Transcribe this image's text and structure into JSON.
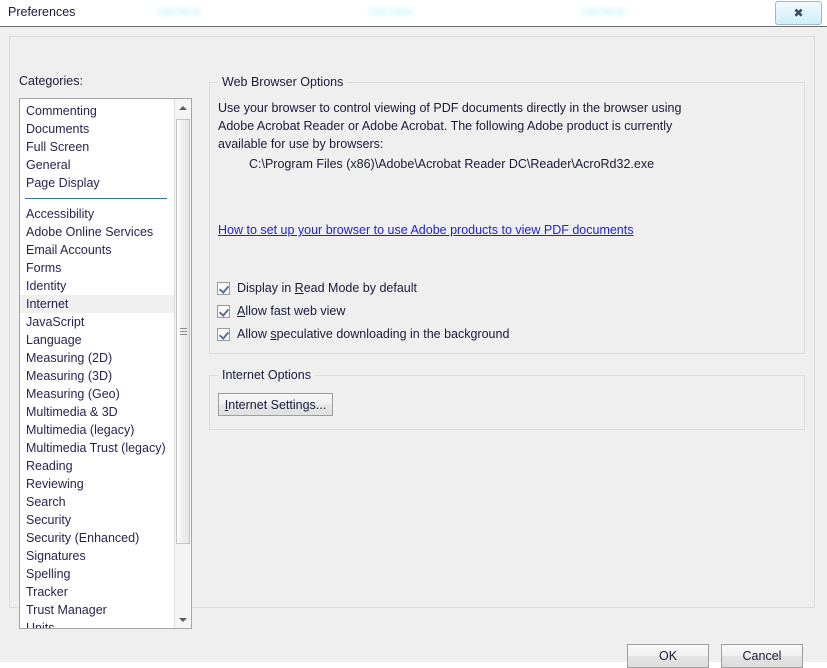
{
  "window": {
    "title": "Preferences",
    "close_glyph": "✖",
    "ghost_labels": [
      "Get Now",
      "Get Now",
      "Get Now"
    ]
  },
  "categories": {
    "label_before": "Cate",
    "label_accel": "g",
    "label_after": "ories:",
    "selected": "Internet",
    "group_one": [
      "Commenting",
      "Documents",
      "Full Screen",
      "General",
      "Page Display"
    ],
    "group_two": [
      "Accessibility",
      "Adobe Online Services",
      "Email Accounts",
      "Forms",
      "Identity",
      "Internet",
      "JavaScript",
      "Language",
      "Measuring (2D)",
      "Measuring (3D)",
      "Measuring (Geo)",
      "Multimedia & 3D",
      "Multimedia (legacy)",
      "Multimedia Trust (legacy)",
      "Reading",
      "Reviewing",
      "Search",
      "Security",
      "Security (Enhanced)",
      "Signatures",
      "Spelling",
      "Tracker",
      "Trust Manager",
      "Units"
    ]
  },
  "web_browser_options": {
    "group_title": "Web Browser Options",
    "description": "Use your browser to control viewing of PDF documents directly in the browser using Adobe Acrobat Reader or Adobe Acrobat. The following Adobe product is currently available for use by browsers:",
    "exe_path": "C:\\Program Files (x86)\\Adobe\\Acrobat Reader DC\\Reader\\AcroRd32.exe",
    "help_link": "How to set up your browser to use Adobe products to view PDF documents",
    "link_color": "#2222cc",
    "checkboxes": [
      {
        "before": "Display in ",
        "accel": "R",
        "after": "ead Mode by default",
        "checked": true
      },
      {
        "before": "",
        "accel": "A",
        "after": "llow fast web view",
        "checked": true
      },
      {
        "before": "Allow ",
        "accel": "s",
        "after": "peculative downloading in the background",
        "checked": true
      }
    ]
  },
  "internet_options": {
    "group_title": "Internet Options",
    "button_accel": "I",
    "button_after": "nternet Settings..."
  },
  "footer": {
    "ok_label": "OK",
    "cancel_label": "Cancel"
  }
}
